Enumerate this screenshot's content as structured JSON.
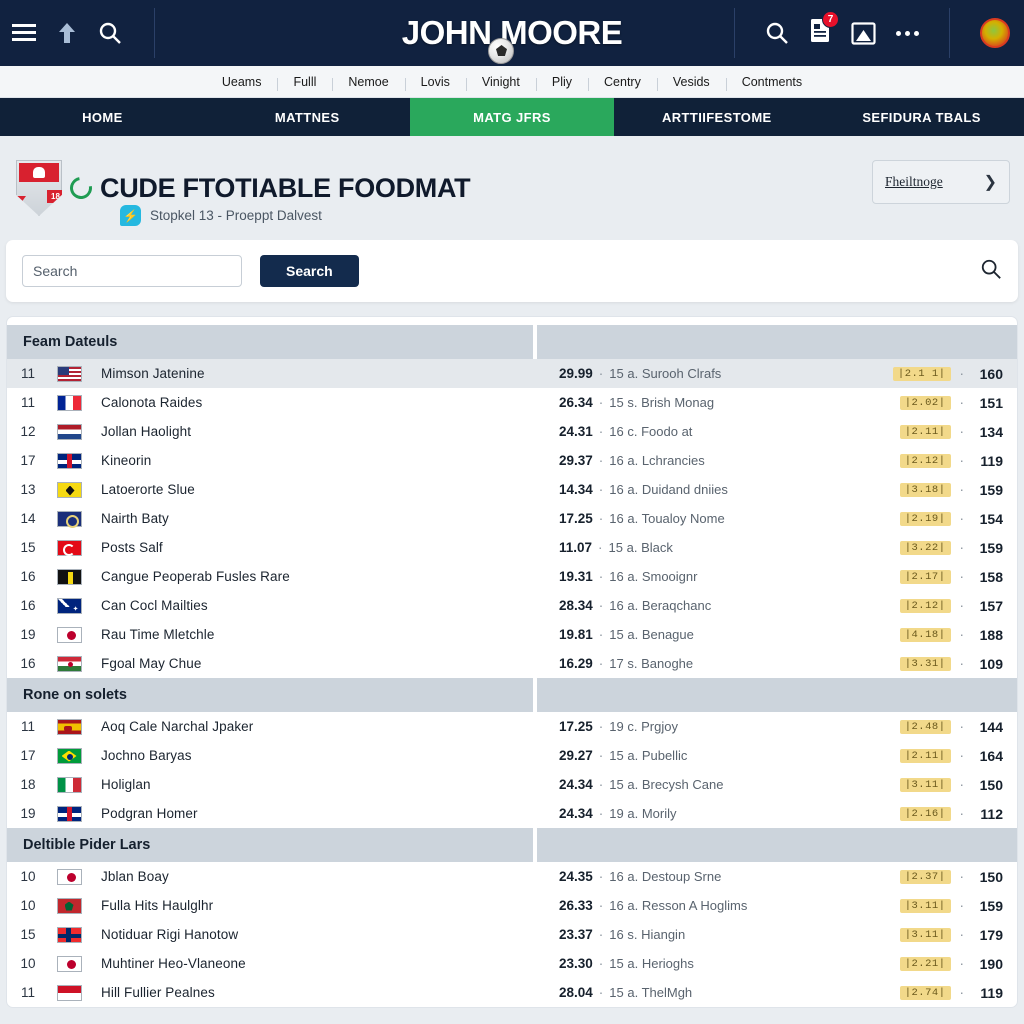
{
  "topbar": {
    "menu_icon": "hamburger-menu-icon",
    "up_icon": "arrow-up-icon",
    "search_icon": "search-icon",
    "brand_title": "JOHN MOORE",
    "right_search_icon": "search-icon",
    "doc_icon": "document-icon",
    "doc_badge": "7",
    "image_icon": "image-icon",
    "more_icon": "more-options-icon",
    "avatar": "user-avatar"
  },
  "subnav": {
    "items": [
      {
        "label": "Ueams"
      },
      {
        "label": "Fulll"
      },
      {
        "label": "Nemoe"
      },
      {
        "label": "Lovis"
      },
      {
        "label": "Vinight"
      },
      {
        "label": "Pliy"
      },
      {
        "label": "Centry"
      },
      {
        "label": "Vesids"
      },
      {
        "label": "Contments"
      }
    ]
  },
  "mainnav": {
    "tabs": [
      {
        "label": "HOME",
        "active": false
      },
      {
        "label": "MATTNES",
        "active": false
      },
      {
        "label": "MATG JFRS",
        "active": true
      },
      {
        "label": "ARTTIIFESTOME",
        "active": false
      },
      {
        "label": "SEFIDURA TBALS",
        "active": false
      }
    ],
    "active_color": "#2aa85c"
  },
  "title_area": {
    "crest_badge": "18",
    "title": "CUDE FTOTIABLE FOODMAT",
    "subtitle": "Stopkel 13 - Proeppt Dalvest",
    "sub_pill_icon": "lightning-icon",
    "corner_button": {
      "label": "Fheiltnoge",
      "chevron": "chevron-right-icon"
    }
  },
  "search": {
    "placeholder": "Search",
    "button_label": "Search",
    "right_icon": "search-icon"
  },
  "table": {
    "sections": [
      {
        "header": "Feam Dateuls",
        "rows": [
          {
            "rank": "11",
            "flag": "fl-us",
            "flag_name": "flag-united-states",
            "name": "Mimson Jatenine",
            "mid_num": "29.99",
            "mid_txt": "15 a. Surooh Clrafs",
            "chip": "|2.1 1|",
            "score": "160",
            "highlight": true
          },
          {
            "rank": "11",
            "flag": "fl-fr",
            "flag_name": "flag-france",
            "name": "Calonota Raides",
            "mid_num": "26.34",
            "mid_txt": "15 s. Brish Monag",
            "chip": "|2.02|",
            "score": "151",
            "highlight": false
          },
          {
            "rank": "12",
            "flag": "fl-nl",
            "flag_name": "flag-netherlands",
            "name": "Jollan Haolight",
            "mid_num": "24.31",
            "mid_txt": "16 c. Foodo at",
            "chip": "|2.11|",
            "score": "134",
            "highlight": false
          },
          {
            "rank": "17",
            "flag": "fl-gb",
            "flag_name": "flag-united-kingdom",
            "name": "Kineorin",
            "mid_num": "29.37",
            "mid_txt": "16 a. Lchrancies",
            "chip": "|2.12|",
            "score": "119",
            "highlight": false
          },
          {
            "rank": "13",
            "flag": "fl-ye",
            "flag_name": "flag-yellow-crest",
            "name": "Latoerorte Slue",
            "mid_num": "14.34",
            "mid_txt": "16 a. Duidand dniies",
            "chip": "|3.18|",
            "score": "159",
            "highlight": false
          },
          {
            "rank": "14",
            "flag": "fl-bl",
            "flag_name": "flag-blue-emblem",
            "name": "Nairth Baty",
            "mid_num": "17.25",
            "mid_txt": "16 a. Toualoy Nome",
            "chip": "|2.19|",
            "score": "154",
            "highlight": false
          },
          {
            "rank": "15",
            "flag": "fl-tr",
            "flag_name": "flag-turkey",
            "name": "Posts Salf",
            "mid_num": "11.07",
            "mid_txt": "15 a. Black",
            "chip": "|3.22|",
            "score": "159",
            "highlight": false
          },
          {
            "rank": "16",
            "flag": "fl-bn",
            "flag_name": "flag-brunei",
            "name": "Cangue Peoperab Fusles Rare",
            "mid_num": "19.31",
            "mid_txt": "16 a. Smooignr",
            "chip": "|2.17|",
            "score": "158",
            "highlight": false
          },
          {
            "rank": "16",
            "flag": "fl-au",
            "flag_name": "flag-australia",
            "name": "Can Cocl Mailties",
            "mid_num": "28.34",
            "mid_txt": "16 a. Beraqchanc",
            "chip": "|2.12|",
            "score": "157",
            "highlight": false
          },
          {
            "rank": "19",
            "flag": "fl-jp",
            "flag_name": "flag-japan",
            "name": "Rau Time Mletchle",
            "mid_num": "19.81",
            "mid_txt": "15 a. Benague",
            "chip": "|4.18|",
            "score": "188",
            "highlight": false
          },
          {
            "rank": "16",
            "flag": "fl-hu",
            "flag_name": "flag-hungary",
            "name": "Fgoal May Chue",
            "mid_num": "16.29",
            "mid_txt": "17 s. Banoghe",
            "chip": "|3.31|",
            "score": "109",
            "highlight": false
          }
        ]
      },
      {
        "header": "Rone on solets",
        "rows": [
          {
            "rank": "11",
            "flag": "fl-es",
            "flag_name": "flag-spain",
            "name": "Aoq Cale Narchal Jpaker",
            "mid_num": "17.25",
            "mid_txt": "19 c. Prgjoy",
            "chip": "|2.48|",
            "score": "144",
            "highlight": false
          },
          {
            "rank": "17",
            "flag": "fl-br",
            "flag_name": "flag-brazil",
            "name": "Jochno Baryas",
            "mid_num": "29.27",
            "mid_txt": "15 a. Pubellic",
            "chip": "|2.11|",
            "score": "164",
            "highlight": false
          },
          {
            "rank": "18",
            "flag": "fl-it",
            "flag_name": "flag-italy",
            "name": "Holiglan",
            "mid_num": "24.34",
            "mid_txt": "15 a. Brecysh Cane",
            "chip": "|3.11|",
            "score": "150",
            "highlight": false
          },
          {
            "rank": "19",
            "flag": "fl-gb",
            "flag_name": "flag-united-kingdom",
            "name": "Podgran Homer",
            "mid_num": "24.34",
            "mid_txt": "19 a. Morily",
            "chip": "|2.16|",
            "score": "112",
            "highlight": false
          }
        ]
      },
      {
        "header": "Deltible Pider Lars",
        "rows": [
          {
            "rank": "10",
            "flag": "fl-jp",
            "flag_name": "flag-japan",
            "name": "Jblan Boay",
            "mid_num": "24.35",
            "mid_txt": "16 a. Destoup Srne",
            "chip": "|2.37|",
            "score": "150",
            "highlight": false
          },
          {
            "rank": "10",
            "flag": "fl-ma",
            "flag_name": "flag-morocco",
            "name": "Fulla Hits Haulglhr",
            "mid_num": "26.33",
            "mid_txt": "16 a. Resson A Hoglims",
            "chip": "|3.11|",
            "score": "159",
            "highlight": false
          },
          {
            "rank": "15",
            "flag": "fl-no2",
            "flag_name": "flag-norway",
            "name": "Notiduar Rigi Hanotow",
            "mid_num": "23.37",
            "mid_txt": "16 s. Hiangin",
            "chip": "|3.11|",
            "score": "179",
            "highlight": false
          },
          {
            "rank": "10",
            "flag": "fl-jp",
            "flag_name": "flag-japan",
            "name": "Muhtiner Heo-Vlaneone",
            "mid_num": "23.30",
            "mid_txt": "15 a. Herioghs",
            "chip": "|2.21|",
            "score": "190",
            "highlight": false
          },
          {
            "rank": "11",
            "flag": "fl-id",
            "flag_name": "flag-indonesia",
            "name": "Hill Fullier Pealnes",
            "mid_num": "28.04",
            "mid_txt": "15 a. ThelMgh",
            "chip": "|2.74|",
            "score": "119",
            "highlight": false
          }
        ]
      }
    ]
  }
}
